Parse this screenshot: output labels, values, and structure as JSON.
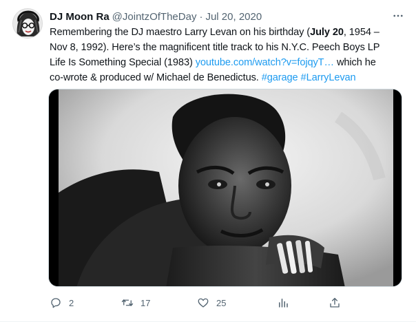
{
  "tweet": {
    "author": {
      "display_name": "DJ Moon Ra",
      "handle": "@JointzOfTheDay",
      "separator": "·",
      "date": "Jul 20, 2020"
    },
    "more_icon": "more-horizontal-icon",
    "text": {
      "line1_a": "Remembering the DJ maestro Larry Levan on his birthday (",
      "line1_bold": "July 20",
      "line1_b": ", 1954 –",
      "line2": "Nov 8, 1992). Here’s the magnificent title track to his N.Y.C. Peech Boys LP",
      "line3_a": "Life Is Something Special (1983) ",
      "line3_link": "youtube.com/watch?v=fojqyT…",
      "line3_b": " which he",
      "line4_a": "co-wrote & produced w/ Michael de Benedictus. ",
      "line4_tag1": "#garage",
      "line4_space": " ",
      "line4_tag2": "#LarryLevan"
    },
    "media": {
      "description_icon": "photo-black-white-portrait"
    },
    "actions": {
      "replies": "2",
      "retweets": "17",
      "likes": "25",
      "reply_icon": "reply-icon",
      "retweet_icon": "retweet-icon",
      "like_icon": "heart-icon",
      "views_icon": "analytics-icon",
      "share_icon": "share-icon"
    },
    "colors": {
      "link": "#1d9bf0",
      "muted": "#536471",
      "text": "#0f1419"
    }
  }
}
